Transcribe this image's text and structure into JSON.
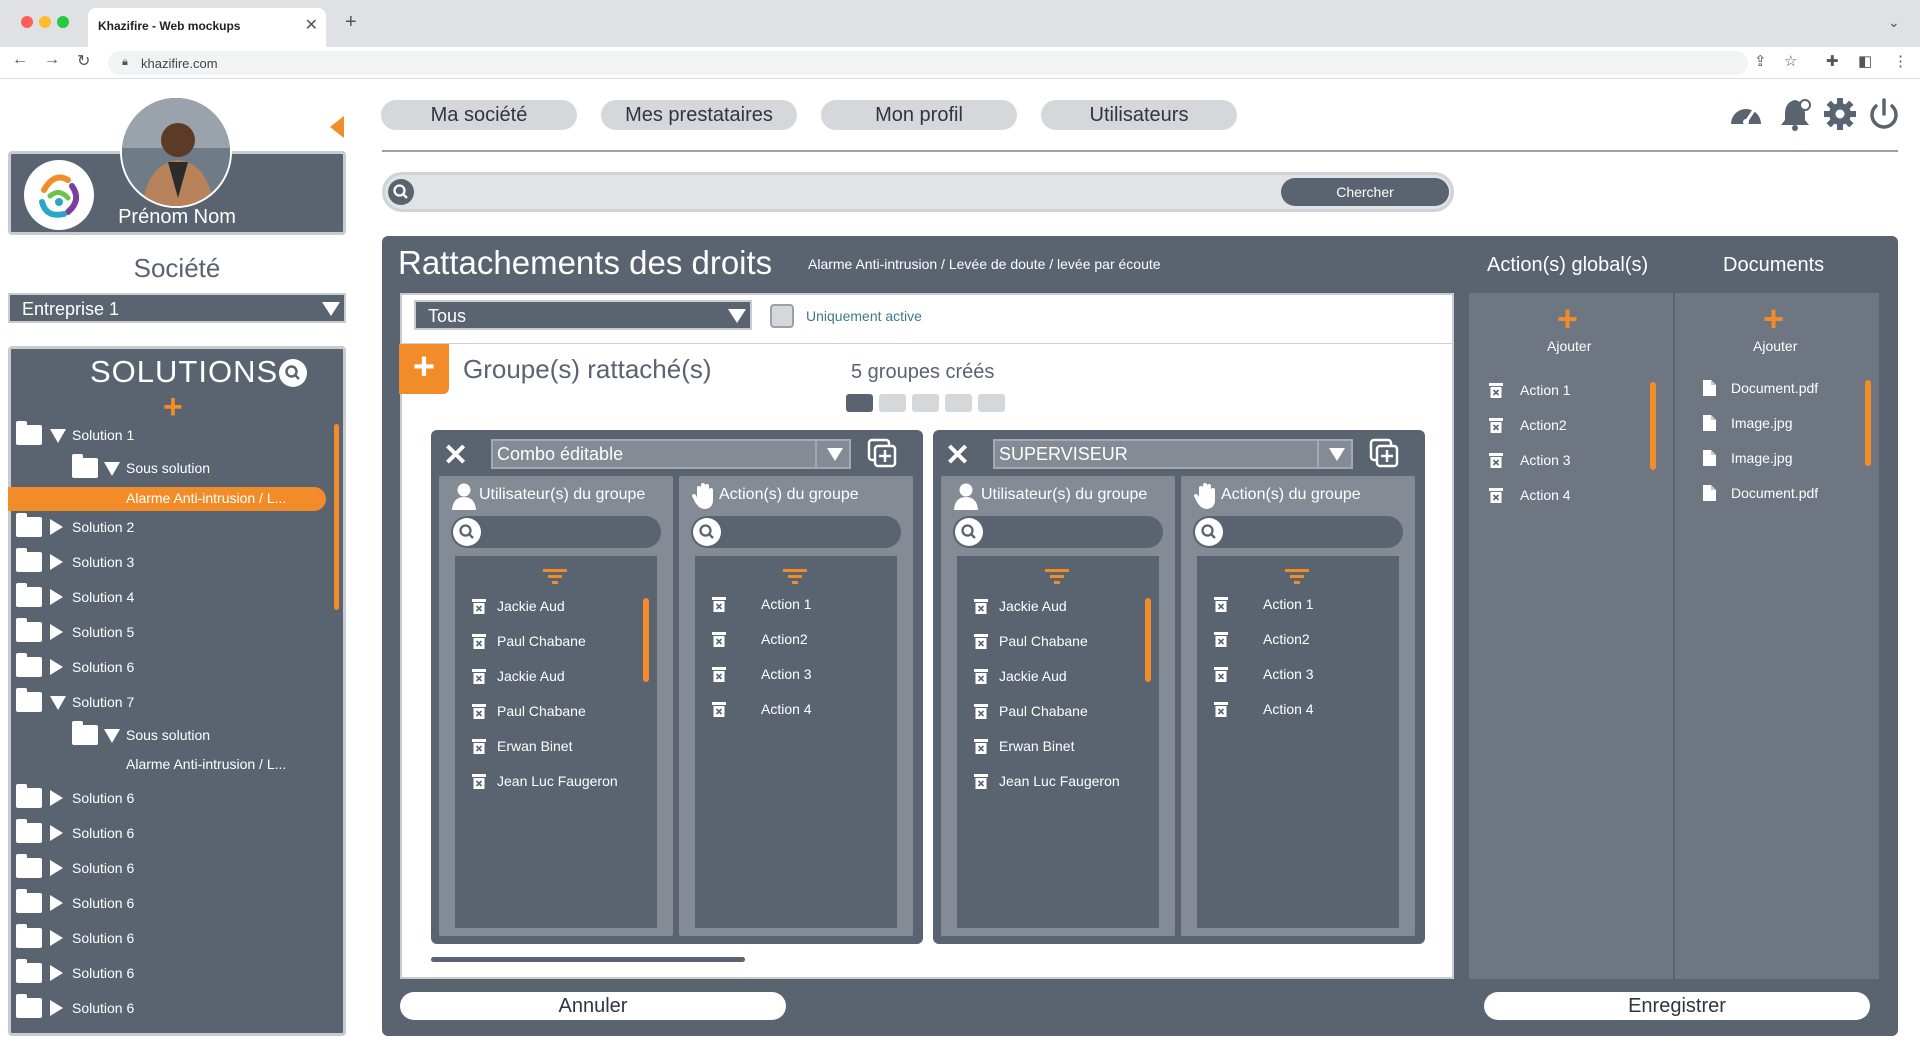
{
  "browser": {
    "tab_title": "Khazifire - Web mockups",
    "url": "khazifire.com"
  },
  "profile": {
    "name": "Prénom Nom"
  },
  "company": {
    "title": "Société",
    "selected": "Entreprise 1"
  },
  "solutions": {
    "title": "SOLUTIONS",
    "tree": [
      {
        "label": "Solution 1",
        "expanded": true
      },
      {
        "label": "Sous solution",
        "expanded": true
      },
      {
        "label": "Alarme Anti-intrusion / L...",
        "selected": true
      },
      {
        "label": "Solution 2"
      },
      {
        "label": "Solution 3"
      },
      {
        "label": "Solution 4"
      },
      {
        "label": "Solution 5"
      },
      {
        "label": "Solution 6"
      },
      {
        "label": "Solution 7",
        "expanded": true
      },
      {
        "label": "Sous solution",
        "expanded": true
      },
      {
        "label": "Alarme Anti-intrusion / L..."
      },
      {
        "label": "Solution 6"
      },
      {
        "label": "Solution 6"
      },
      {
        "label": "Solution 6"
      },
      {
        "label": "Solution 6"
      },
      {
        "label": "Solution 6"
      },
      {
        "label": "Solution 6"
      },
      {
        "label": "Solution 6"
      }
    ]
  },
  "nav": {
    "tabs": [
      "Ma société",
      "Mes prestataires",
      "Mon profil",
      "Utilisateurs"
    ],
    "icons": [
      "dashboard-icon",
      "bell-icon",
      "gear-icon",
      "power-icon"
    ]
  },
  "search": {
    "button_label": "Chercher"
  },
  "main": {
    "title": "Rattachements des droits",
    "breadcrumb": "Alarme Anti-intrusion / Levée de doute / levée par écoute",
    "filter_selected": "Tous",
    "active_only_label": "Uniquement active",
    "groups_title": "Groupe(s) rattaché(s)",
    "groups_count": "5 groupes créés",
    "pagination": {
      "pages": 5,
      "current": 1
    },
    "groups": [
      {
        "name": "Combo éditable",
        "users_header": "Utilisateur(s) du groupe",
        "actions_header": "Action(s) du groupe",
        "users": [
          "Jackie Aud",
          "Paul Chabane",
          "Jackie Aud",
          "Paul Chabane",
          "Erwan Binet",
          "Jean Luc Faugeron"
        ],
        "actions": [
          "Action 1",
          "Action2",
          "Action 3",
          "Action 4"
        ]
      },
      {
        "name": "SUPERVISEUR",
        "users_header": "Utilisateur(s) du groupe",
        "actions_header": "Action(s) du groupe",
        "users": [
          "Jackie Aud",
          "Paul Chabane",
          "Jackie Aud",
          "Paul Chabane",
          "Erwan Binet",
          "Jean Luc Faugeron"
        ],
        "actions": [
          "Action 1",
          "Action2",
          "Action 3",
          "Action 4"
        ]
      }
    ]
  },
  "global_actions": {
    "title": "Action(s) global(s)",
    "add_label": "Ajouter",
    "items": [
      "Action 1",
      "Action2",
      "Action 3",
      "Action 4"
    ]
  },
  "documents": {
    "title": "Documents",
    "add_label": "Ajouter",
    "items": [
      "Document.pdf",
      "Image.jpg",
      "Image.jpg",
      "Document.pdf"
    ]
  },
  "buttons": {
    "cancel": "Annuler",
    "save": "Enregistrer"
  },
  "colors": {
    "accent": "#f28c28",
    "panel": "#5a6370",
    "panel_light": "#848b94"
  }
}
